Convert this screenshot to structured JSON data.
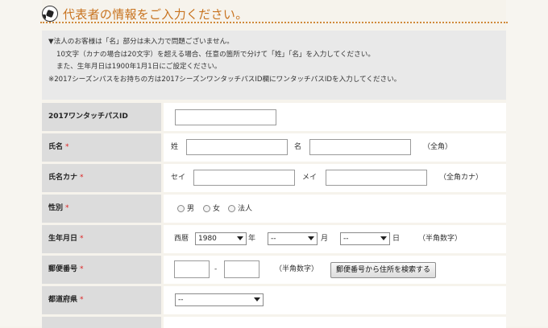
{
  "header": {
    "title": "代表者の情報をご入力ください。"
  },
  "notice": {
    "lines": [
      "▼法人のお客様は「名」部分は未入力で問題ございません。",
      "10文字（カナの場合は20文字）を超える場合、任意の箇所で分けて「姓」「名」を入力してください。",
      "また、生年月日は1900年1月1日にご設定ください。",
      "※2017シーズンパスをお持ちの方は2017シーズンワンタッチパスID欄にワンタッチパスIDを入力してください。"
    ]
  },
  "form": {
    "required_mark": "*",
    "pass_id": {
      "label": "2017ワンタッチパスID",
      "value": ""
    },
    "name": {
      "label": "氏名",
      "sei_label": "姓",
      "sei_value": "",
      "mei_label": "名",
      "mei_value": "",
      "note": "（全角）"
    },
    "kana": {
      "label": "氏名カナ",
      "sei_label": "セイ",
      "sei_value": "",
      "mei_label": "メイ",
      "mei_value": "",
      "note": "（全角カナ）"
    },
    "gender": {
      "label": "性別",
      "options": [
        "男",
        "女",
        "法人"
      ]
    },
    "birthday": {
      "label": "生年月日",
      "era": "西暦",
      "year_value": "1980",
      "year_unit": "年",
      "month_value": "--",
      "month_unit": "月",
      "day_value": "--",
      "day_unit": "日",
      "note": "（半角数字）"
    },
    "postal": {
      "label": "郵便番号",
      "value1": "",
      "separator": "-",
      "value2": "",
      "note": "（半角数字）",
      "search_button": "郵便番号から住所を検索する"
    },
    "prefecture": {
      "label": "都道府県",
      "value": "--"
    }
  }
}
